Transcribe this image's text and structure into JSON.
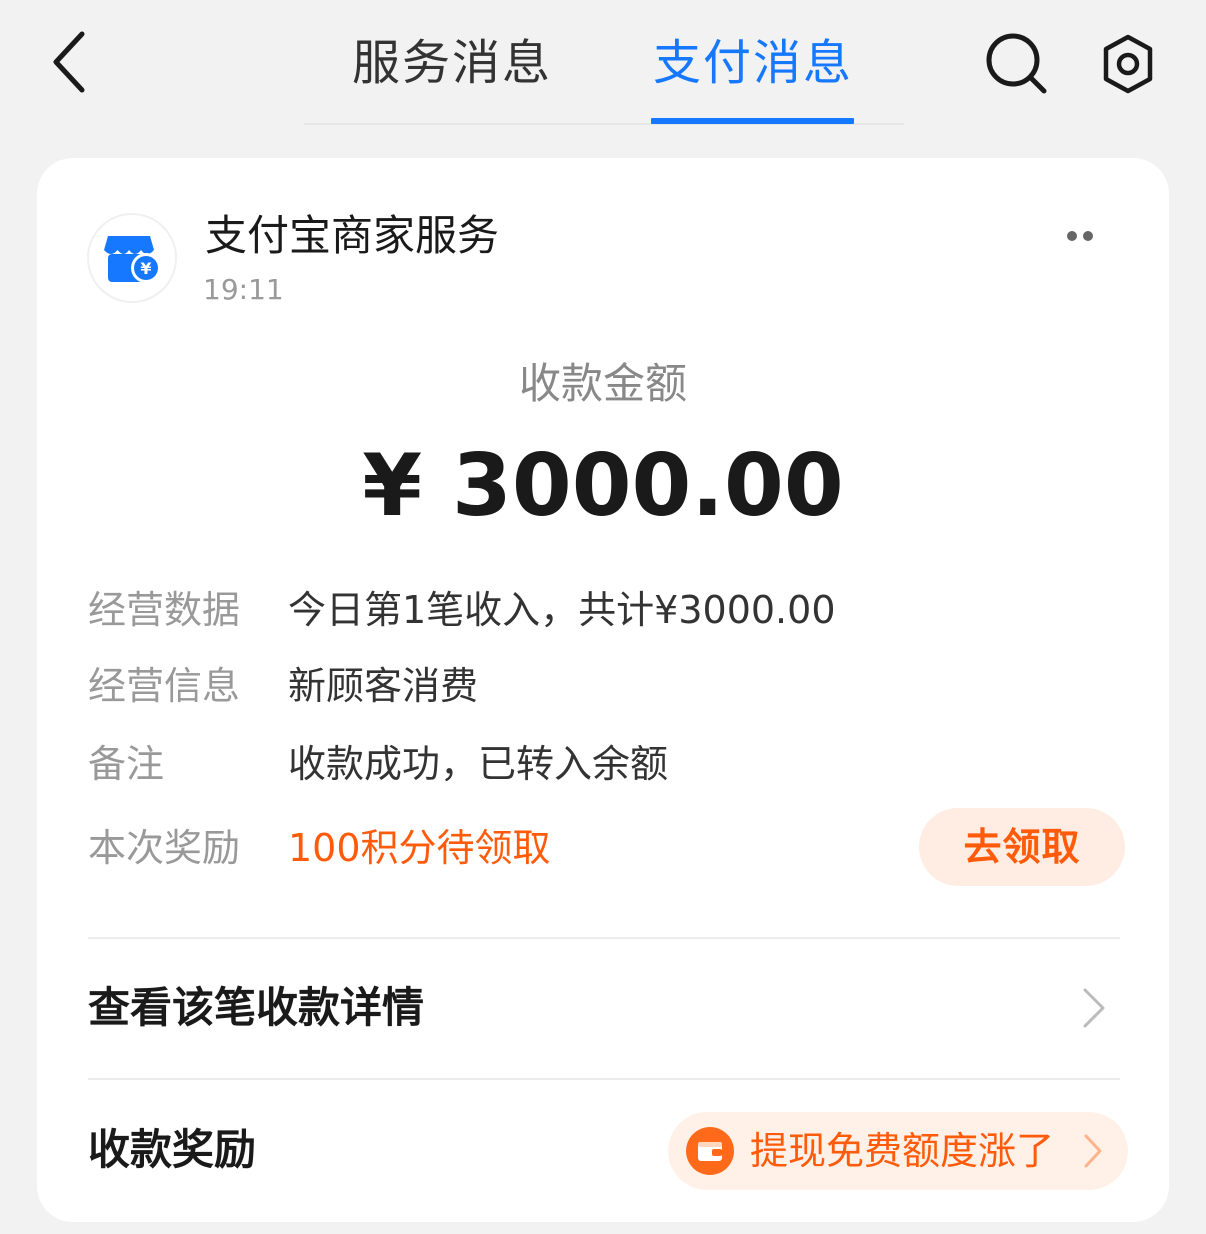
{
  "header": {
    "back_icon": "chevron-left-icon",
    "tabs": [
      {
        "label": "服务消息",
        "active": false
      },
      {
        "label": "支付消息",
        "active": true
      }
    ],
    "search_icon": "search-icon",
    "settings_icon": "gear-icon",
    "accent_color": "#1677ff"
  },
  "message": {
    "merchant_name": "支付宝商家服务",
    "merchant_icon": "shop-yuan-icon",
    "time": "19:11",
    "more_icon": "more-dots-icon",
    "amount_label": "收款金额",
    "amount": "¥ 3000.00",
    "info": [
      {
        "label": "经营数据",
        "value": "今日第1笔收入，共计¥3000.00"
      },
      {
        "label": "经营信息",
        "value": "新顾客消费"
      },
      {
        "label": "备注",
        "value": "收款成功，已转入余额"
      },
      {
        "label": "本次奖励",
        "value": "100积分待领取"
      }
    ],
    "claim_button": "去领取",
    "detail_link": "查看该笔收款详情",
    "reward_label": "收款奖励",
    "reward_pill": "提现免费额度涨了",
    "reward_icon": "wallet-icon",
    "highlight_color": "#ff5b0a"
  }
}
